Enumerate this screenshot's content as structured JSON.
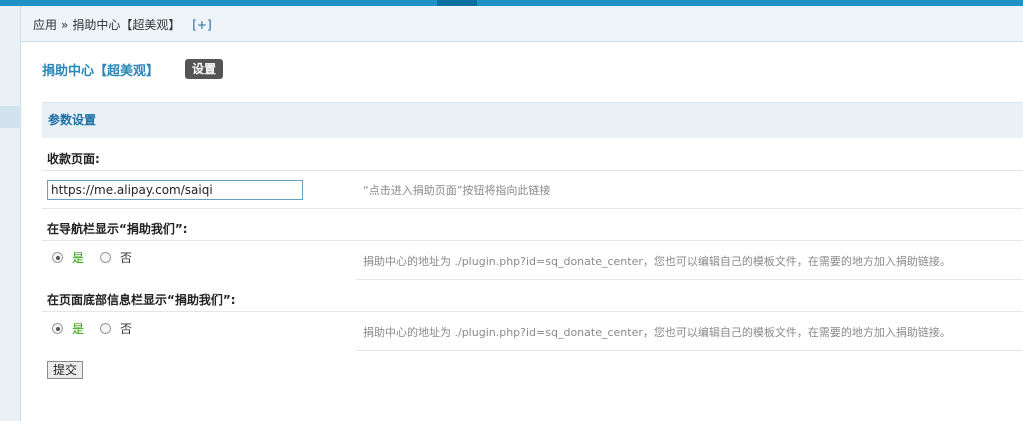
{
  "breadcrumb": {
    "items": [
      "应用",
      "捐助中心【超美观】"
    ],
    "separator": "»",
    "add_link": "[+]"
  },
  "plugin": {
    "title": "捐助中心【超美观】",
    "settings_tab": "设置"
  },
  "section": {
    "title": "参数设置"
  },
  "fields": {
    "pay_page": {
      "label": "收款页面:",
      "value": "https://me.alipay.com/saiqi",
      "tip": "“点击进入捐助页面”按钮将指向此链接"
    },
    "nav_show": {
      "label": "在导航栏显示“捐助我们”:",
      "yes": "是",
      "no": "否",
      "selected": "是",
      "tip": "捐助中心的地址为 ./plugin.php?id=sq_donate_center，您也可以编辑自己的模板文件，在需要的地方加入捐助链接。"
    },
    "footer_show": {
      "label": "在页面底部信息栏显示“捐助我们”:",
      "yes": "是",
      "no": "否",
      "selected": "是",
      "tip": "捐助中心的地址为 ./plugin.php?id=sq_donate_center，您也可以编辑自己的模板文件，在需要的地方加入捐助链接。"
    }
  },
  "submit_label": "提交",
  "colors": {
    "accent": "#1e92c5",
    "title": "#2a87b8",
    "yes": "#22a000"
  }
}
